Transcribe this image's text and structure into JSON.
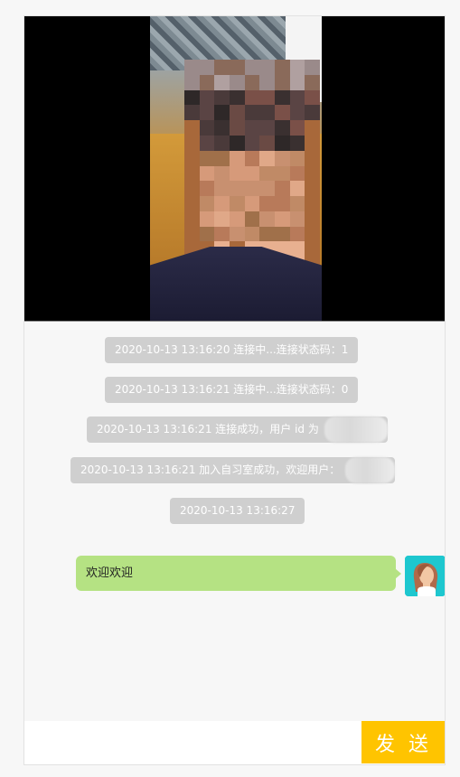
{
  "system_messages": [
    {
      "text": "2020-10-13 13:16:20 连接中...连接状态码：1"
    },
    {
      "text": "2020-10-13 13:16:21 连接中...连接状态码：0"
    },
    {
      "text": "2020-10-13 13:16:21 连接成功，用户 id 为"
    },
    {
      "text": "2020-10-13 13:16:21 加入自习室成功，欢迎用户："
    },
    {
      "text": "2020-10-13 13:16:27"
    }
  ],
  "user_message": {
    "text": "欢迎欢迎"
  },
  "input": {
    "value": "",
    "placeholder": ""
  },
  "send_button": {
    "label": "发 送"
  },
  "colors": {
    "system_bubble": "#cfcfcf",
    "user_bubble": "#b5e283",
    "send_button": "#ffc400",
    "avatar_bg": "#1ec7cf"
  }
}
